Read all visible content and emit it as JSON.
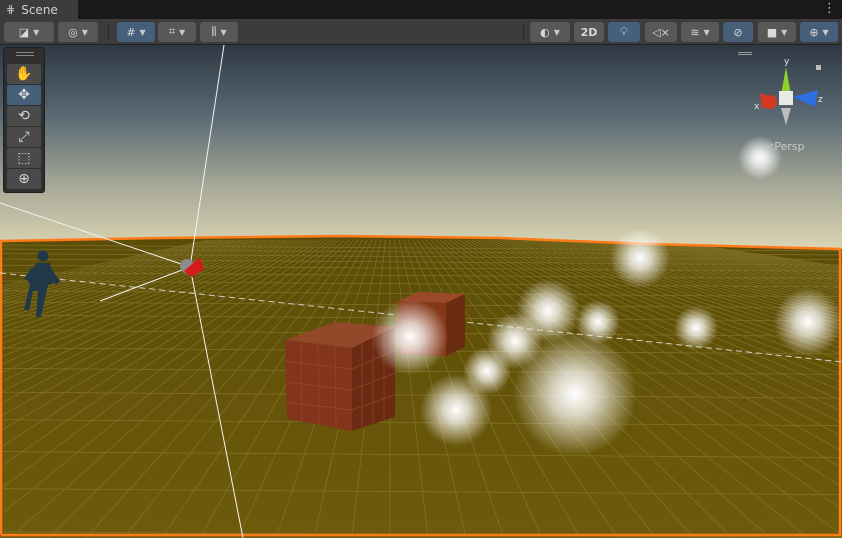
{
  "tab": {
    "title": "Scene",
    "icon": "grid-icon",
    "menu": "⋮"
  },
  "toolbar": {
    "items": [
      {
        "name": "draw-mode-dropdown",
        "icon": "brush-icon"
      },
      {
        "name": "global-dropdown",
        "icon": "globe-icon"
      },
      {
        "name": "grid-snap-dropdown",
        "icon": "grid-icon",
        "active": true
      },
      {
        "name": "snap-increment-dropdown",
        "icon": "grid-snap-icon"
      },
      {
        "name": "ruler-dropdown",
        "icon": "ruler-icon"
      },
      {
        "name": "shading-mode-dropdown",
        "icon": "sphere-icon"
      },
      {
        "name": "2d-toggle",
        "label": "2D"
      },
      {
        "name": "lighting-toggle",
        "icon": "lightbulb-icon",
        "active": true
      },
      {
        "name": "audio-toggle",
        "icon": "audio-mute-icon"
      },
      {
        "name": "effects-dropdown",
        "icon": "layers-icon"
      },
      {
        "name": "hidden-objects-toggle",
        "icon": "eye-slash-icon",
        "active": true
      },
      {
        "name": "camera-dropdown",
        "icon": "camera-icon"
      },
      {
        "name": "gizmos-dropdown",
        "icon": "gizmo-globe-icon",
        "active": true
      }
    ],
    "label_2d": "2D"
  },
  "palette": {
    "tools": [
      {
        "name": "hand-tool",
        "icon": "hand-icon",
        "active": false
      },
      {
        "name": "move-tool",
        "icon": "move-icon",
        "active": true
      },
      {
        "name": "rotate-tool",
        "icon": "rotate-icon",
        "active": false
      },
      {
        "name": "scale-tool",
        "icon": "scale-icon",
        "active": false
      },
      {
        "name": "rect-tool",
        "icon": "rect-icon",
        "active": false
      },
      {
        "name": "transform-tool",
        "icon": "transform-icon",
        "active": false
      }
    ],
    "glyphs": [
      "✋",
      "✥",
      "⟲",
      "⤢",
      "⬚",
      "⊕"
    ]
  },
  "orientation_gizmo": {
    "axis_x": "x",
    "axis_y": "y",
    "axis_z": "z",
    "projection_label": "Persp"
  },
  "colors": {
    "ground": "#6b5a0a",
    "selection_outline": "#ff7a18",
    "cube": "#8a3c1c",
    "sky_top": "#2f3a44",
    "sky_horizon": "#d8d4b8",
    "active_button": "#46607c"
  }
}
